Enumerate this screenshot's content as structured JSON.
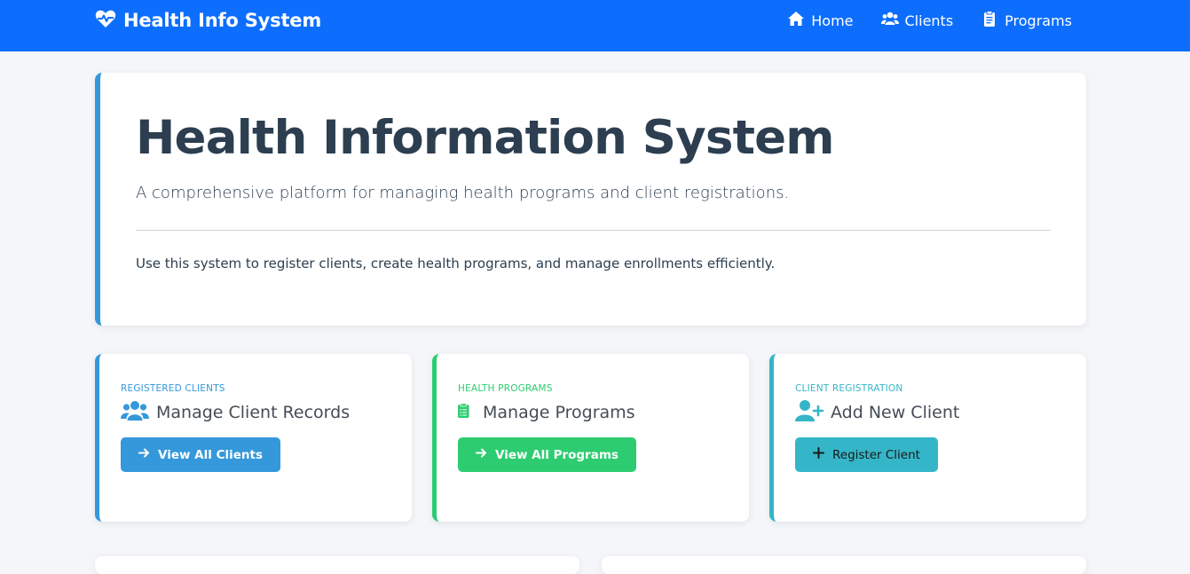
{
  "navbar": {
    "brand": "Health Info System",
    "brand_icon": "heartbeat-icon",
    "links": [
      {
        "label": "Home",
        "icon": "home-icon"
      },
      {
        "label": "Clients",
        "icon": "users-icon"
      },
      {
        "label": "Programs",
        "icon": "clipboard-icon"
      }
    ]
  },
  "hero": {
    "title": "Health Information System",
    "lead": "A comprehensive platform for managing health programs and client registrations.",
    "text": "Use this system to register clients, create health programs, and manage enrollments efficiently."
  },
  "cards": [
    {
      "eyebrow": "Registered Clients",
      "heading": "Manage Client Records",
      "icon": "users-icon",
      "button": "View All Clients",
      "button_icon": "arrow-right-icon",
      "accent": "#3498db"
    },
    {
      "eyebrow": "Health Programs",
      "heading": "Manage Programs",
      "icon": "clipboard-list-icon",
      "button": "View All Programs",
      "button_icon": "arrow-right-icon",
      "accent": "#2ecc71"
    },
    {
      "eyebrow": "Client Registration",
      "heading": "Add New Client",
      "icon": "user-plus-icon",
      "button": "Register Client",
      "button_icon": "plus-icon",
      "accent": "#35b5c8"
    }
  ],
  "colors": {
    "navbar": "#0d6efd",
    "background": "#f4f6f9",
    "text": "#2c3e50"
  }
}
